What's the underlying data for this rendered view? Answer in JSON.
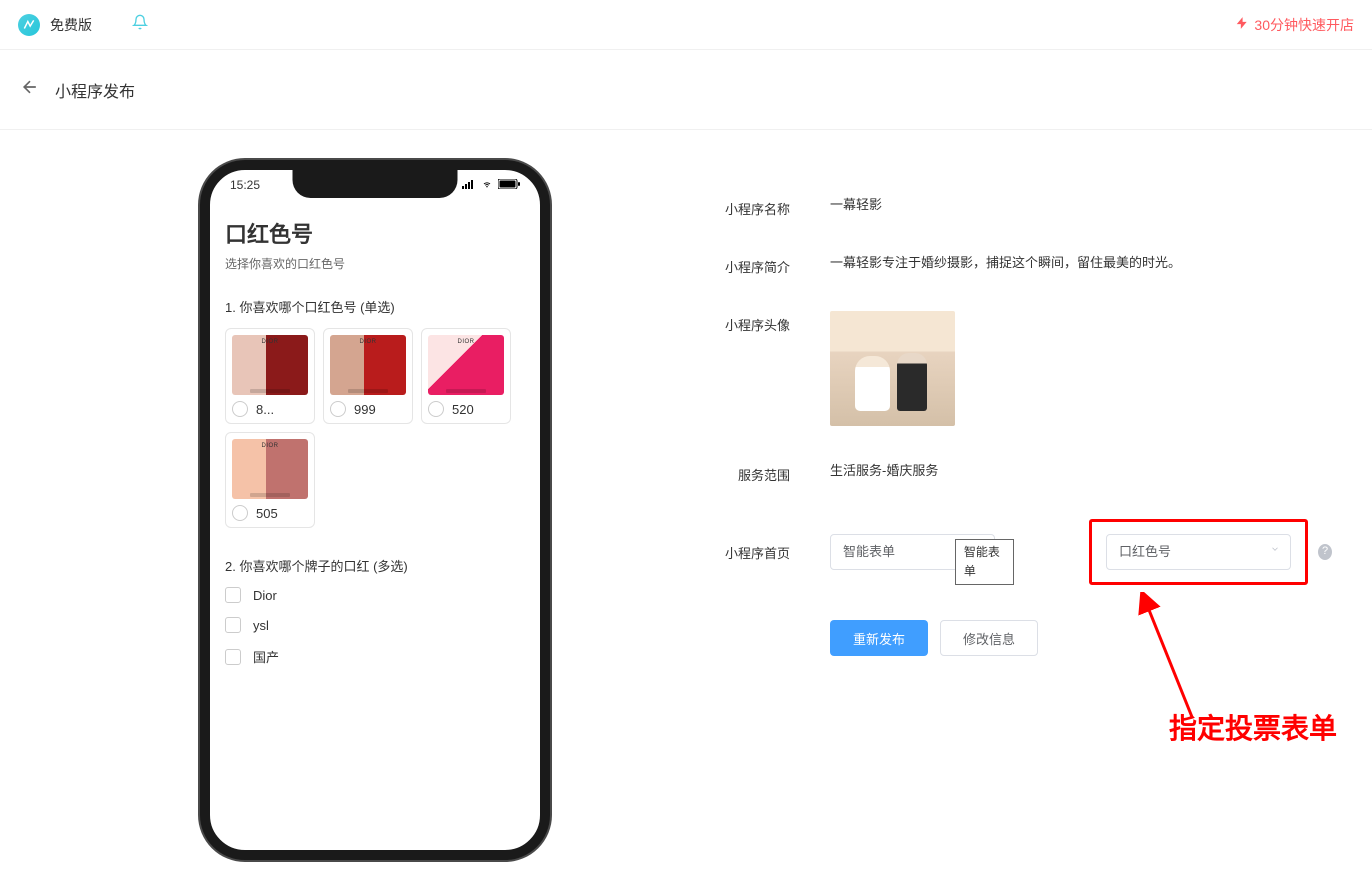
{
  "topbar": {
    "plan_label": "免费版",
    "quick_shop_label": "30分钟快速开店"
  },
  "page": {
    "title": "小程序发布"
  },
  "phone": {
    "time": "15:25",
    "title": "口红色号",
    "subtitle": "选择你喜欢的口红色号",
    "q1_label": "1. 你喜欢哪个口红色号 (单选)",
    "options": [
      {
        "label": "8..."
      },
      {
        "label": "999"
      },
      {
        "label": "520"
      },
      {
        "label": "505"
      }
    ],
    "q2_label": "2. 你喜欢哪个牌子的口红 (多选)",
    "brands": [
      {
        "label": "Dior"
      },
      {
        "label": "ysl"
      },
      {
        "label": "国产"
      }
    ]
  },
  "form": {
    "name_label": "小程序名称",
    "name_value": "一幕轻影",
    "intro_label": "小程序简介",
    "intro_value": "一幕轻影专注于婚纱摄影，捕捉这个瞬间，留住最美的时光。",
    "avatar_label": "小程序头像",
    "scope_label": "服务范围",
    "scope_value": "生活服务-婚庆服务",
    "home_label": "小程序首页",
    "select1_value": "智能表单",
    "tooltip_value": "智能表单",
    "select2_value": "口红色号",
    "republish_btn": "重新发布",
    "modify_btn": "修改信息"
  },
  "annotation": {
    "text": "指定投票表单"
  }
}
